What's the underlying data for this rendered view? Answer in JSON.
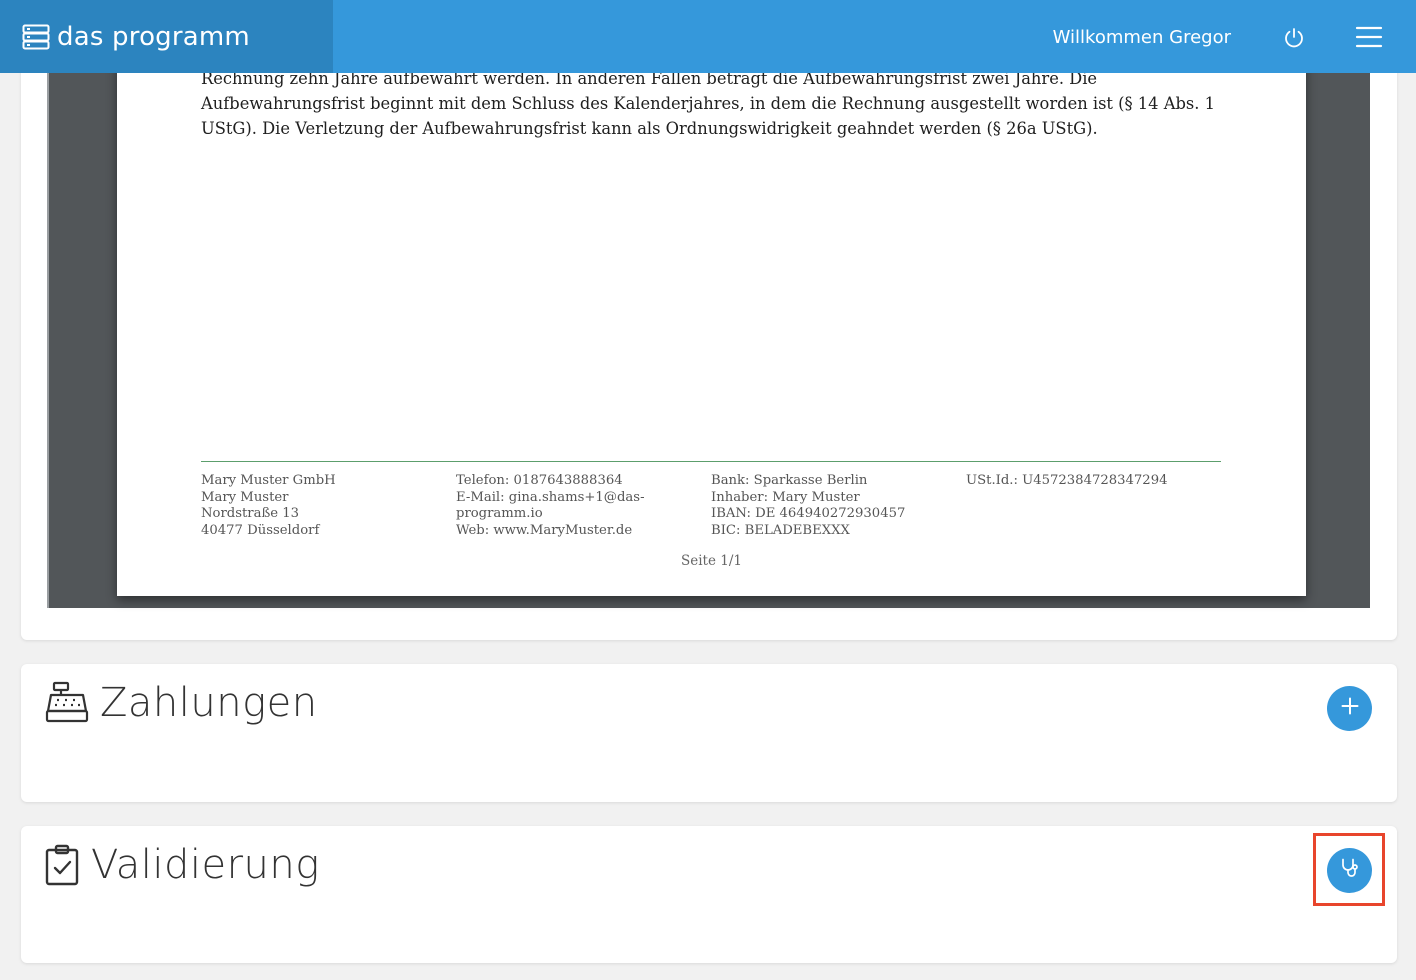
{
  "app": {
    "brand": "das programm",
    "welcome": "Willkommen Gregor",
    "icons": {
      "brand": "server-stack-icon",
      "power": "power-icon",
      "menu": "hamburger-menu-icon"
    },
    "accent_color": "#3598db"
  },
  "document": {
    "body_lines": [
      "Rechnung zehn Jahre aufbewahrt werden. In anderen Fällen beträgt die Aufbewahrungsfrist zwei Jahre. Die",
      "Aufbewahrungsfrist beginnt mit dem Schluss des Kalenderjahres, in dem die Rechnung ausgestellt worden ist (§ 14 Abs. 1",
      "UStG). Die Verletzung der Aufbewahrungsfrist kann als Ordnungswidrigkeit geahndet werden (§ 26a UStG)."
    ],
    "footer": {
      "company": [
        "Mary Muster GmbH",
        "Mary Muster",
        "Nordstraße 13",
        "40477 Düsseldorf"
      ],
      "contact": [
        "Telefon: 0187643888364",
        "E-Mail: gina.shams+1@das-",
        "programm.io",
        "Web: www.MaryMuster.de"
      ],
      "bank": [
        "Bank: Sparkasse Berlin",
        "Inhaber: Mary Muster",
        "IBAN: DE 464940272930457",
        "BIC: BELADEBEXXX"
      ],
      "tax": [
        "USt.Id.: U4572384728347294"
      ]
    },
    "page_label": "Seite 1/1"
  },
  "zahlungen": {
    "title": "Zahlungen",
    "icon": "cash-register-icon",
    "add_icon": "plus-icon"
  },
  "validierung": {
    "title": "Validierung",
    "icon": "clipboard-check-icon",
    "action_icon": "stethoscope-icon",
    "highlight_color": "#e8452c"
  }
}
